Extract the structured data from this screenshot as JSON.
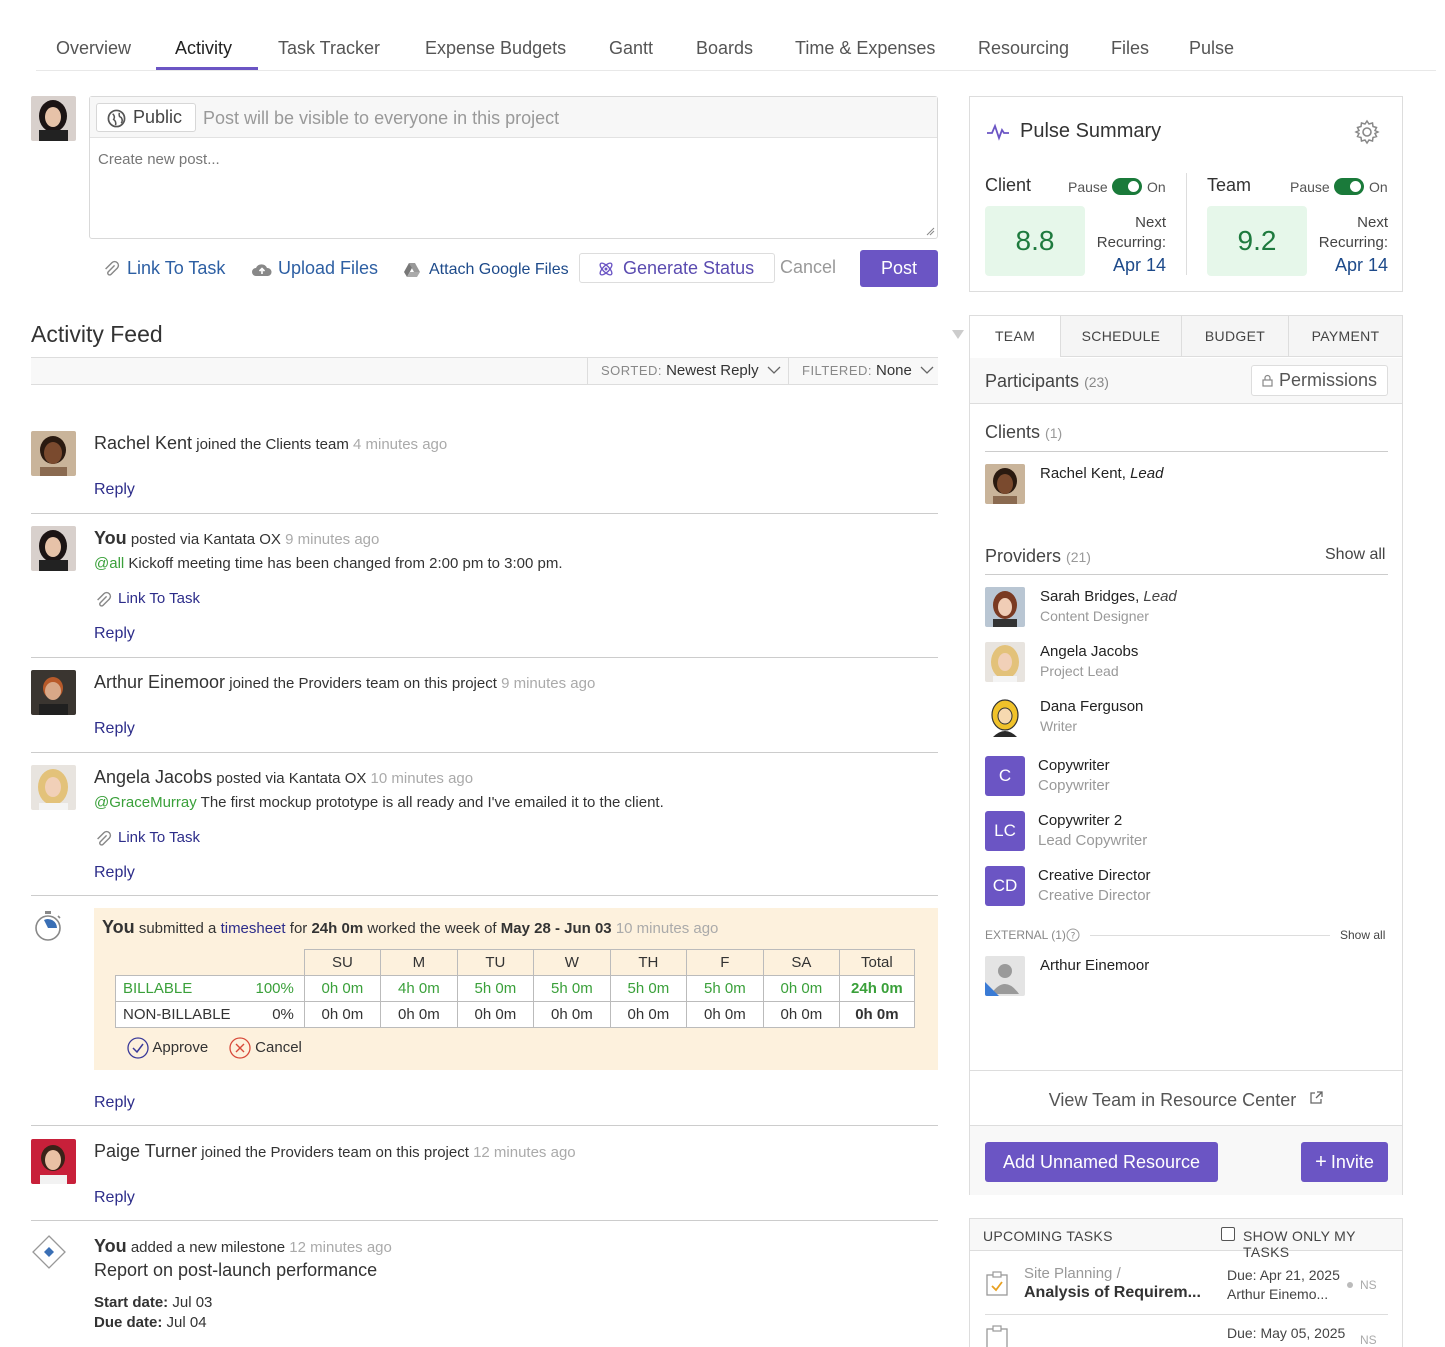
{
  "nav": {
    "tabs": [
      "Overview",
      "Activity",
      "Task Tracker",
      "Expense Budgets",
      "Gantt",
      "Boards",
      "Time & Expenses",
      "Resourcing",
      "Files",
      "Pulse"
    ],
    "active": "Activity"
  },
  "composer": {
    "visibility_label": "Public",
    "visibility_text": "Post will be visible to everyone in this project",
    "placeholder": "Create new post...",
    "link_to_task": "Link To Task",
    "upload_files": "Upload Files",
    "attach_google": "Attach Google Files",
    "generate_status": "Generate Status",
    "cancel": "Cancel",
    "post": "Post"
  },
  "feed": {
    "title": "Activity Feed",
    "sorted_label": "SORTED:",
    "sorted_value": "Newest Reply",
    "filtered_label": "FILTERED:",
    "filtered_value": "None",
    "reply": "Reply",
    "link_to_task": "Link To Task",
    "items": [
      {
        "name": "Rachel Kent",
        "action": "joined the Clients team",
        "time": "4 minutes ago"
      },
      {
        "name": "You",
        "action": "posted via Kantata OX",
        "time": "9 minutes ago",
        "mention": "@all",
        "body": "Kickoff meeting time has been changed from 2:00 pm to 3:00 pm."
      },
      {
        "name": "Arthur Einemoor",
        "action": "joined the Providers team on this project",
        "time": "9 minutes ago"
      },
      {
        "name": "Angela Jacobs",
        "action": "posted via Kantata OX",
        "time": "10 minutes ago",
        "mention": "@GraceMurray",
        "body": "The first mockup prototype is all ready and I've emailed it to the client."
      },
      {
        "name": "Paige Turner",
        "action": "joined the Providers team on this project",
        "time": "12 minutes ago"
      }
    ],
    "timesheet": {
      "name": "You",
      "submitted": "submitted a",
      "link": "timesheet",
      "for": "for",
      "hours": "24h 0m",
      "worked": "worked the week of",
      "week": "May 28 - Jun 03",
      "time": "10 minutes ago",
      "headers": [
        "SU",
        "M",
        "TU",
        "W",
        "TH",
        "F",
        "SA",
        "Total"
      ],
      "rows": [
        {
          "label": "BILLABLE",
          "pct": "100%",
          "values": [
            "0h 0m",
            "4h 0m",
            "5h 0m",
            "5h 0m",
            "5h 0m",
            "5h 0m",
            "0h 0m"
          ],
          "total": "24h 0m"
        },
        {
          "label": "NON-BILLABLE",
          "pct": "0%",
          "values": [
            "0h 0m",
            "0h 0m",
            "0h 0m",
            "0h 0m",
            "0h 0m",
            "0h 0m",
            "0h 0m"
          ],
          "total": "0h 0m"
        }
      ],
      "approve": "Approve",
      "cancel": "Cancel"
    },
    "milestone": {
      "name": "You",
      "action": "added a new milestone",
      "time": "12 minutes ago",
      "title": "Report on post-launch performance",
      "start_label": "Start date:",
      "start": "Jul 03",
      "due_label": "Due date:",
      "due": "Jul 04"
    }
  },
  "pulse": {
    "title": "Pulse Summary",
    "pause": "Pause",
    "on": "On",
    "next": "Next",
    "recurring": "Recurring:",
    "client_label": "Client",
    "client_score": "8.8",
    "client_date": "Apr 14",
    "team_label": "Team",
    "team_score": "9.2",
    "team_date": "Apr 14"
  },
  "team": {
    "tabs": [
      "TEAM",
      "SCHEDULE",
      "BUDGET",
      "PAYMENT"
    ],
    "participants_label": "Participants",
    "participants_count": "(23)",
    "permissions": "Permissions",
    "clients_label": "Clients",
    "clients_count": "(1)",
    "client": {
      "name": "Rachel Kent",
      "role": "Lead"
    },
    "providers_label": "Providers",
    "providers_count": "(21)",
    "show_all": "Show all",
    "providers": [
      {
        "name": "Sarah Bridges",
        "tag": "Lead",
        "role": "Content Designer"
      },
      {
        "name": "Angela Jacobs",
        "role": "Project Lead"
      },
      {
        "name": "Dana Ferguson",
        "role": "Writer"
      },
      {
        "initials": "C",
        "name": "Copywriter",
        "role": "Copywriter"
      },
      {
        "initials": "LC",
        "name": "Copywriter 2",
        "role": "Lead Copywriter"
      },
      {
        "initials": "CD",
        "name": "Creative Director",
        "role": "Creative Director"
      }
    ],
    "external_label": "EXTERNAL (1)",
    "external_show_all": "Show all",
    "external_person": "Arthur Einemoor",
    "view_team": "View Team in Resource Center",
    "add_unnamed": "Add Unnamed Resource",
    "invite": "Invite"
  },
  "tasks": {
    "title": "UPCOMING TASKS",
    "only_mine": "SHOW ONLY MY TASKS",
    "items": [
      {
        "project": "Site Planning /",
        "name": "Analysis of Requirem...",
        "due": "Due: Apr 21, 2025",
        "assignee": "Arthur Einemo...",
        "status": "NS"
      },
      {
        "due": "Due: May 05, 2025",
        "status": "NS"
      }
    ]
  },
  "colors": {
    "accent": "#6b55c4",
    "mention": "#3aa03a",
    "score_bg": "#e6f7ea",
    "timesheet_bg": "#fdf1dd"
  }
}
